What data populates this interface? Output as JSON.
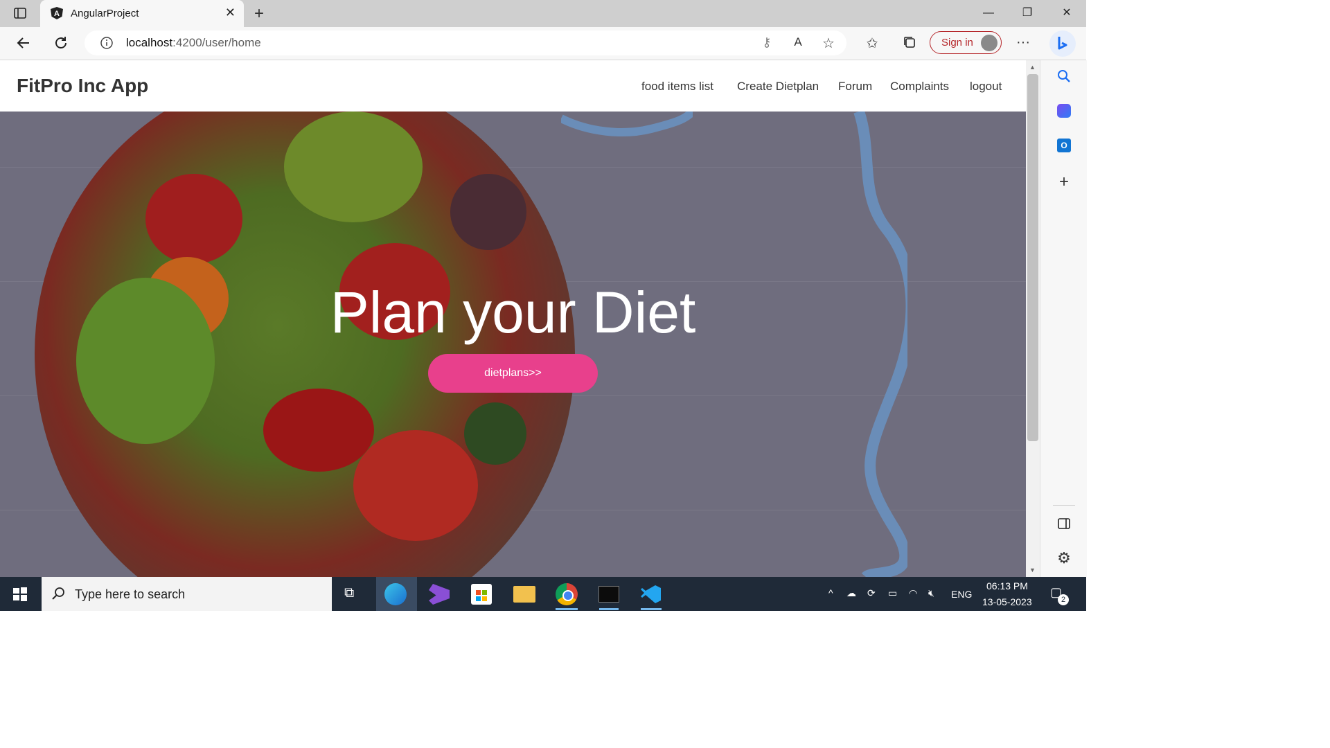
{
  "browser": {
    "tab_title": "AngularProject",
    "url_host": "localhost",
    "url_path": ":4200/user/home",
    "signin_label": "Sign in"
  },
  "app": {
    "brand": "FitPro Inc App",
    "nav": [
      {
        "label": "food items list"
      },
      {
        "label": "Create Dietplan"
      },
      {
        "label": "Forum"
      },
      {
        "label": "Complaints"
      },
      {
        "label": "logout"
      }
    ],
    "hero_title": "Plan your Diet",
    "cta_label": "dietplans>>"
  },
  "taskbar": {
    "search_placeholder": "Type here to search",
    "language": "ENG",
    "time": "06:13 PM",
    "date": "13-05-2023",
    "notification_count": "2"
  },
  "colors": {
    "cta": "#e8408c",
    "hero_overlay": "#6f6d7e",
    "signin": "#b5262a",
    "taskbar": "#1f2a38"
  }
}
